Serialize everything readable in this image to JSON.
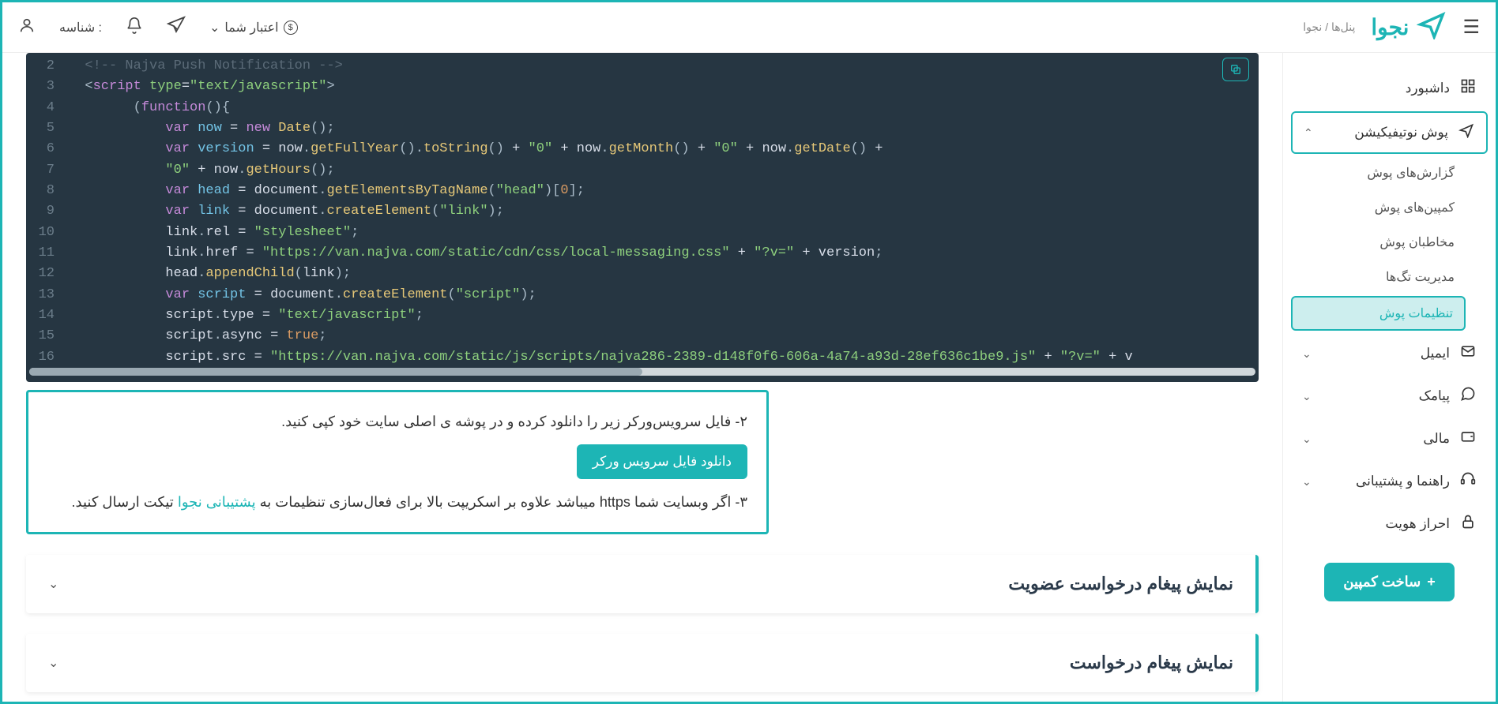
{
  "header": {
    "breadcrumb": "پنل‌ها / نجوا",
    "brand": "نجوا",
    "credit_label": "اعتبار شما",
    "id_label": "شناسه :"
  },
  "sidebar": {
    "dashboard": "داشبورد",
    "push": "پوش نوتیفیکیشن",
    "push_sub": {
      "reports": "گزارش‌های پوش",
      "campaigns": "کمپین‌های پوش",
      "audience": "مخاطبان پوش",
      "tags": "مدیریت تگ‌ها",
      "settings": "تنظیمات پوش"
    },
    "email": "ایمیل",
    "sms": "پیامک",
    "finance": "مالی",
    "support": "راهنما و پشتیبانی",
    "verify": "احراز هویت",
    "create_campaign": "ساخت کمپین"
  },
  "info": {
    "step2": "۲- فایل سرویس‌ورکر زیر را دانلود کرده و در پوشه ی اصلی سایت خود کپی کنید.",
    "download_btn": "دانلود فایل سرویس ورکر",
    "step3_a": "۳- اگر وبسایت شما https میباشد علاوه بر اسکریپت بالا برای فعال‌سازی تنظیمات به ",
    "step3_link": "پشتیبانی نجوا",
    "step3_b": " تیکت ارسال کنید."
  },
  "accordions": {
    "a1": "نمایش پیغام درخواست عضویت",
    "a2": "نمایش پیغام درخواست"
  },
  "code": {
    "l2": "<!-- Najva Push Notification -->",
    "l3_type": "type",
    "l3_val": "\"text/javascript\"",
    "l5_date": "Date",
    "l6_zero": "\"0\"",
    "l8_head": "\"head\"",
    "l9_link": "\"link\"",
    "l10_ss": "\"stylesheet\"",
    "l11_url": "\"https://van.najva.com/static/cdn/css/local-messaging.css\"",
    "l11_qv": "\"?v=\"",
    "l13_script": "\"script\"",
    "l14_tj": "\"text/javascript\"",
    "l16_url": "\"https://van.najva.com/static/js/scripts/najva286-2389-d148f0f6-606a-4a74-a93d-28ef636c1be9.js\"",
    "l16_qv": "\"?v=\""
  }
}
